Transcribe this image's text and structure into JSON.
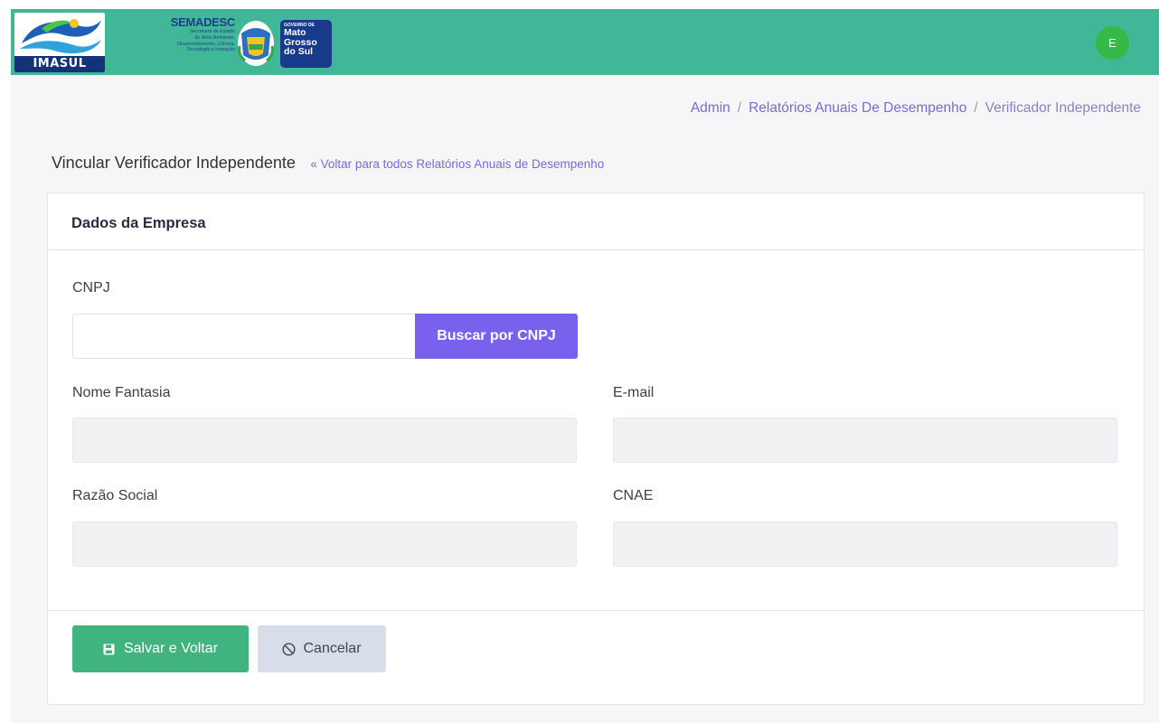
{
  "header": {
    "logo_text": "IMASUL",
    "semadesc_title": "SEMADESC",
    "semadesc_lines": [
      "Secretaria de Estado",
      "do Meio Ambiente,",
      "Desenvolvimento, Ciência,",
      "Tecnologia e Inovação"
    ],
    "gov_small": "GOVERNO DE",
    "gov_lines": [
      "Mato",
      "Grosso",
      "do Sul"
    ],
    "user_initial": "E",
    "colors": {
      "header_bg": "#40b897",
      "gov_badge": "#173a8b",
      "avatar": "#35b948"
    }
  },
  "breadcrumb": {
    "items": [
      "Admin",
      "Relatórios Anuais De Desempenho",
      "Verificador Independente"
    ],
    "separator": "/"
  },
  "page": {
    "title": "Vincular Verificador Independente",
    "back_link": "Voltar para todos Relatórios Anuais de Desempenho",
    "back_icon": "double-chevron-left-icon"
  },
  "card": {
    "title": "Dados da Empresa",
    "fields": {
      "cnpj": {
        "label": "CNPJ",
        "value": "",
        "placeholder": ""
      },
      "nome_fantasia": {
        "label": "Nome Fantasia",
        "value": ""
      },
      "email": {
        "label": "E-mail",
        "value": ""
      },
      "razao_social": {
        "label": "Razão Social",
        "value": ""
      },
      "cnae": {
        "label": "CNAE",
        "value": ""
      }
    },
    "search_button": "Buscar por CNPJ"
  },
  "actions": {
    "save": {
      "label": "Salvar e Voltar",
      "icon": "floppy-disk-icon",
      "color": "#40b37f"
    },
    "cancel": {
      "label": "Cancelar",
      "icon": "ban-icon",
      "color": "#d8dee9"
    }
  },
  "accent": "#7a61ed"
}
